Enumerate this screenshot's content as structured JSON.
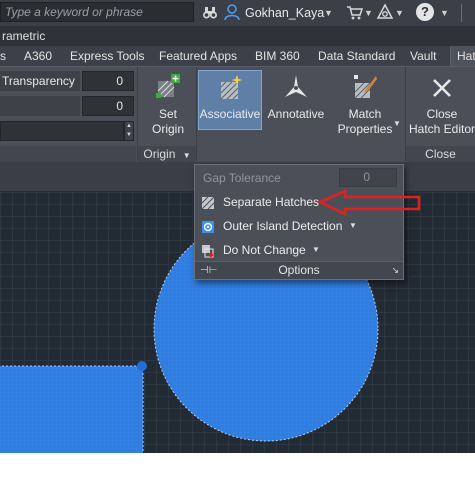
{
  "toolbar": {
    "search_placeholder": "Type a keyword or phrase",
    "user_name": "Gokhan_Kaya",
    "help_label": "?"
  },
  "window": {
    "title_fragment": "rametric"
  },
  "ribbon_tabs": [
    {
      "label": "s"
    },
    {
      "label": "A360"
    },
    {
      "label": "Express Tools"
    },
    {
      "label": "Featured Apps"
    },
    {
      "label": "BIM 360"
    },
    {
      "label": "Data Standard"
    },
    {
      "label": "Vault"
    },
    {
      "label": "Hatc"
    }
  ],
  "properties": {
    "transparency_label": "Transparency",
    "transparency_value": "0",
    "angle_value": "0"
  },
  "origin_panel": {
    "set_origin_line1": "Set",
    "set_origin_line2": "Origin",
    "title": "Origin"
  },
  "options_panel": {
    "associative_label": "Associative",
    "annotative_label": "Annotative",
    "match_line1": "Match",
    "match_line2": "Properties",
    "gap_tolerance_label": "Gap Tolerance",
    "gap_tolerance_value": "0",
    "separate_hatches_label": "Separate Hatches",
    "outer_island_label": "Outer Island Detection",
    "do_not_change_label": "Do Not Change",
    "title": "Options"
  },
  "close_panel": {
    "close_line1": "Close",
    "close_line2": "Hatch Editor",
    "title": "Close"
  },
  "colors": {
    "accent_blue": "#3a8ef0",
    "hatch_fill": "#2f7de0",
    "annotation_red": "#e0201e",
    "ribbon_bg": "#4b5058",
    "canvas_bg": "#222a33"
  }
}
